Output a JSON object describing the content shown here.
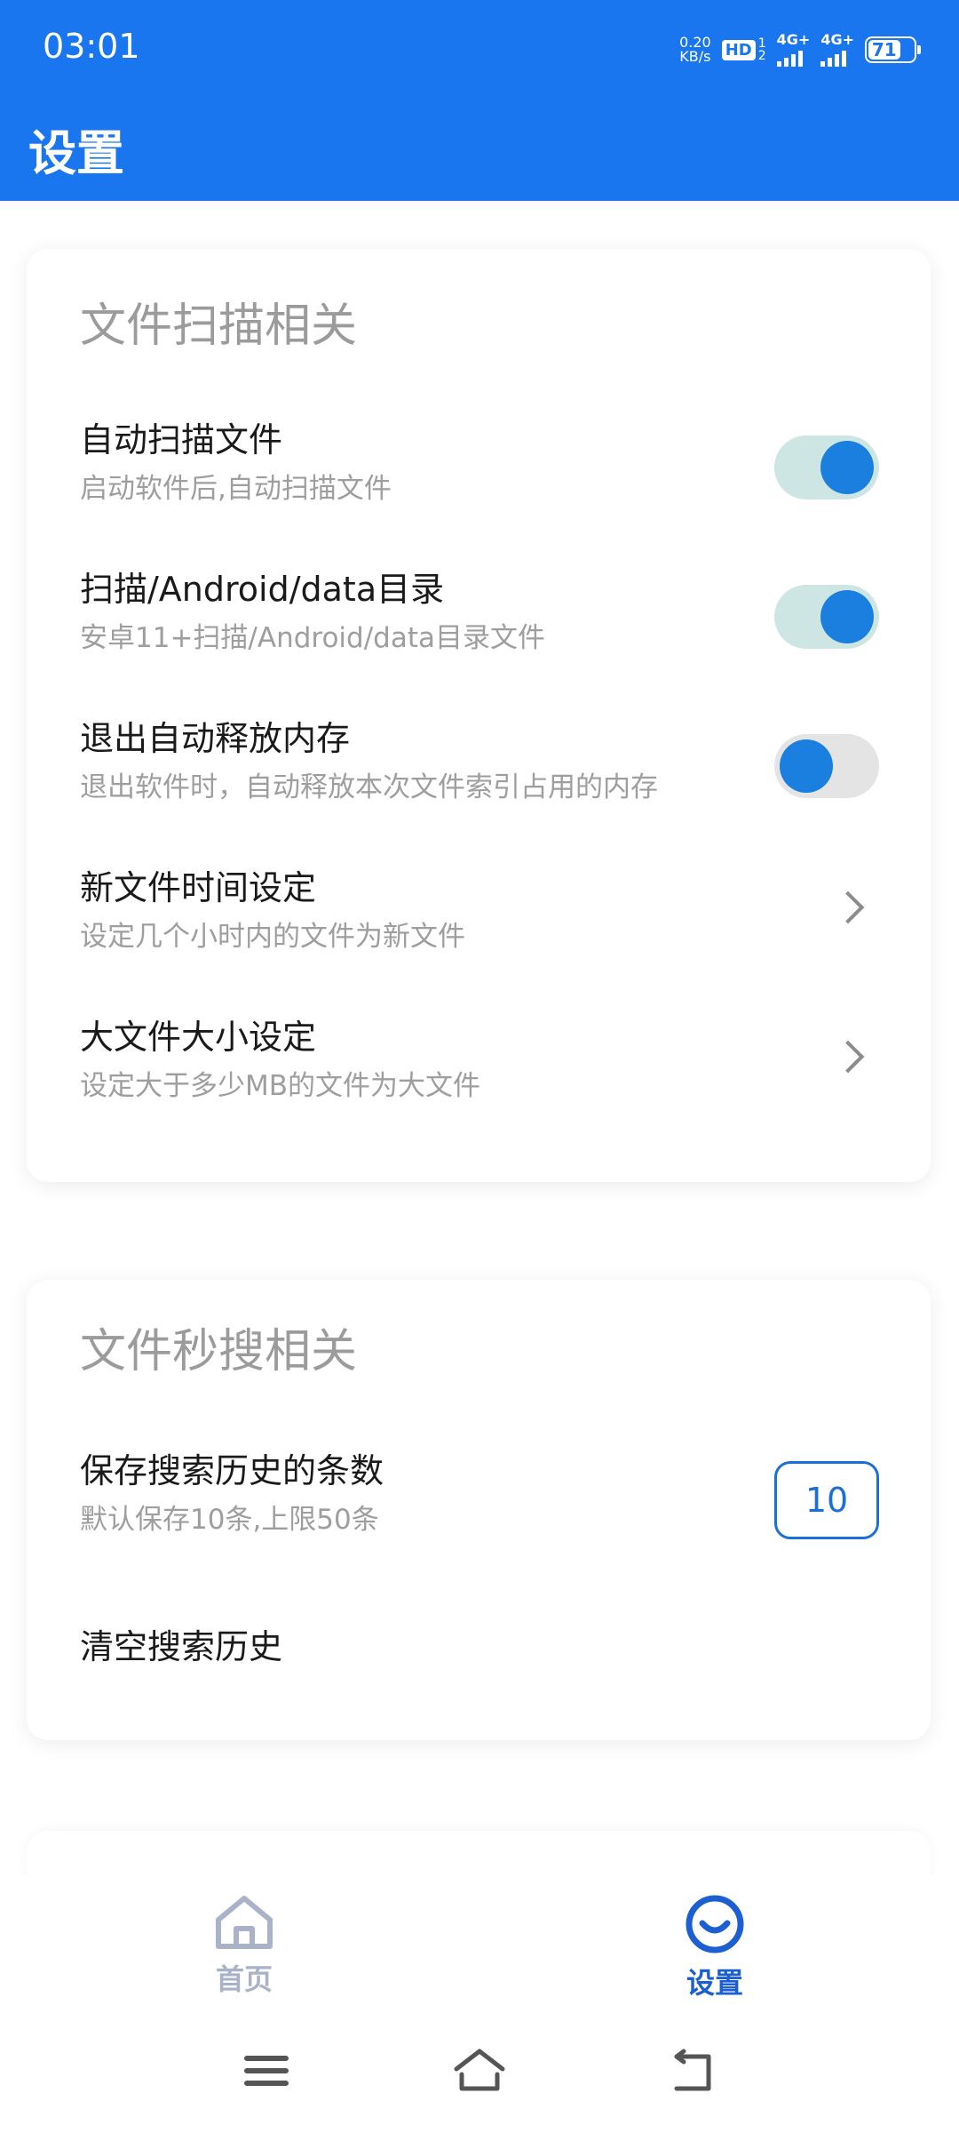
{
  "status_bar": {
    "time": "03:01",
    "net_speed_value": "0.20",
    "net_speed_unit": "KB/s",
    "hd_label": "HD",
    "hd_sim_top": "1",
    "hd_sim_bottom": "2",
    "sim1_network": "4G+",
    "sim2_network": "4G+",
    "battery": "71"
  },
  "header": {
    "title": "设置"
  },
  "file_scan_card": {
    "title": "文件扫描相关",
    "items": [
      {
        "title": "自动扫描文件",
        "subtitle": "启动软件后,自动扫描文件",
        "control": "toggle",
        "on": true
      },
      {
        "title": "扫描/Android/data目录",
        "subtitle": "安卓11+扫描/Android/data目录文件",
        "control": "toggle",
        "on": true
      },
      {
        "title": "退出自动释放内存",
        "subtitle": "退出软件时，自动释放本次文件索引占用的内存",
        "control": "toggle",
        "on": false
      },
      {
        "title": "新文件时间设定",
        "subtitle": "设定几个小时内的文件为新文件",
        "control": "chevron"
      },
      {
        "title": "大文件大小设定",
        "subtitle": "设定大于多少MB的文件为大文件",
        "control": "chevron"
      }
    ]
  },
  "quick_search_card": {
    "title": "文件秒搜相关",
    "history_count": {
      "title": "保存搜索历史的条数",
      "subtitle": "默认保存10条,上限50条",
      "value": "10"
    },
    "clear_history": {
      "title": "清空搜索历史"
    }
  },
  "bottom_nav": {
    "items": [
      {
        "label": "首页",
        "icon": "home-icon",
        "active": false
      },
      {
        "label": "设置",
        "icon": "smile-icon",
        "active": true
      }
    ],
    "active_color": "#1b5fd0",
    "inactive_color": "#a9b2c9"
  },
  "system_nav": {
    "buttons": [
      "menu-icon",
      "home-outline-icon",
      "back-icon"
    ]
  },
  "colors": {
    "primary": "#1976ee",
    "toggle_knob": "#1b7fe0",
    "toggle_track_on": "#cde6e4",
    "toggle_track_off": "#e4e4e4"
  }
}
